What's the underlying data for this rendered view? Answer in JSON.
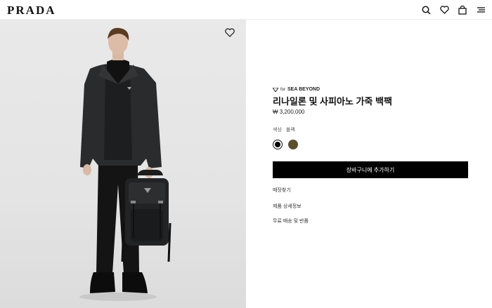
{
  "header": {
    "logo": "PRADA",
    "icons": [
      "search-icon",
      "heart-icon",
      "bag-icon",
      "menu-icon"
    ]
  },
  "product": {
    "image_alt": "Model wearing black jacket holding nylon backpack",
    "collab_prefix": "for",
    "collab_name": "SEA BEYOND",
    "title": "리나일론 및 사피아노 가죽 백팩",
    "price": "₩ 3,200,000",
    "color_label": "색상",
    "color_value": "블랙",
    "colors": [
      {
        "name": "black",
        "hex": "#000000",
        "selected": true
      },
      {
        "name": "olive",
        "hex": "#5a4f2e",
        "selected": false
      }
    ],
    "add_to_cart": "장바구니에 추가하기",
    "links": [
      "매장찾기",
      "제품 상세정보",
      "무료 배송 및 반품"
    ]
  },
  "colors": {
    "background_image": "#e6e6e6",
    "cta": "#000000"
  }
}
